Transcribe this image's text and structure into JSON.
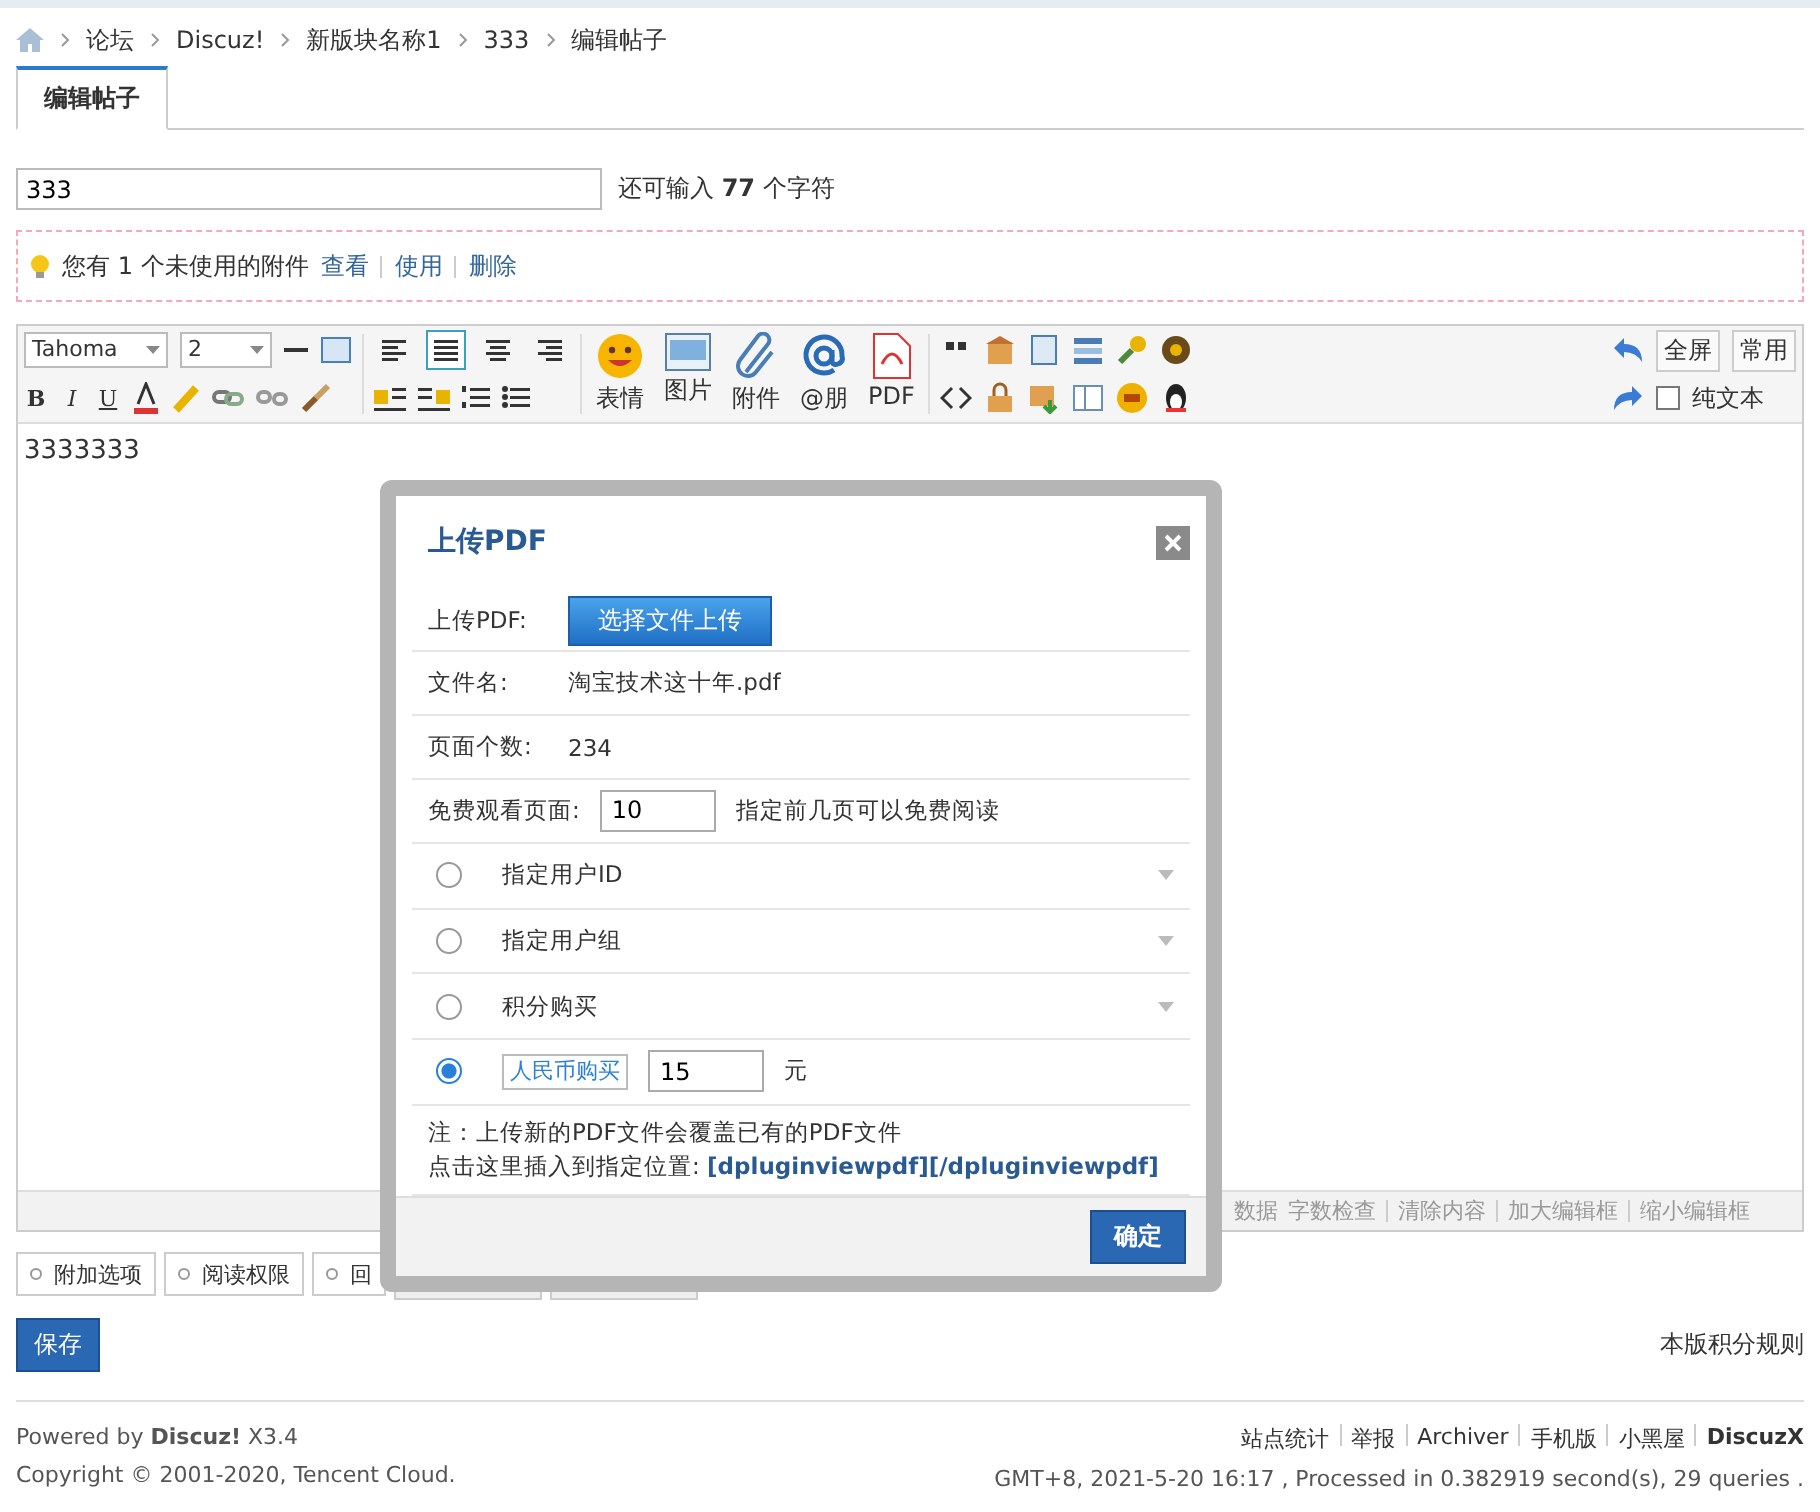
{
  "breadcrumb": [
    "论坛",
    "Discuz!",
    "新版块名称1",
    "333",
    "编辑帖子"
  ],
  "tabs": [
    {
      "label": "编辑帖子",
      "selected": true
    }
  ],
  "subject": {
    "value": "333",
    "hint_prefix": "还可输入",
    "hint_count": "77",
    "hint_suffix": "个字符"
  },
  "notice": {
    "text": "您有 1 个未使用的附件",
    "links": [
      "查看",
      "使用",
      "删除"
    ]
  },
  "toolbar": {
    "font": "Tahoma",
    "size": "2",
    "format_labels": [
      "B",
      "I",
      "U"
    ],
    "align_buttons": [
      {
        "selected": false
      },
      {
        "selected": true
      },
      {
        "selected": false
      },
      {
        "selected": false
      }
    ],
    "big_buttons": [
      {
        "kind": "smiley",
        "label": "表情"
      },
      {
        "kind": "image",
        "label": "图片"
      },
      {
        "kind": "attach",
        "label": "附件"
      },
      {
        "kind": "at",
        "label": "@朋"
      },
      {
        "kind": "pdf",
        "label": "PDF"
      }
    ],
    "right_buttons": [
      "全屏",
      "常用"
    ],
    "plain_text": {
      "label": "纯文本",
      "checked": false
    }
  },
  "editor_content": "3333333",
  "editor_footer": [
    "数据",
    "字数检查",
    "清除内容",
    "加大编辑框",
    "缩小编辑框"
  ],
  "option_tabs": [
    "附加选项",
    "阅读权限",
    "回"
  ],
  "save_button": "保存",
  "rules_link": "本版积分规则",
  "footer": {
    "powered_prefix": "Powered by",
    "brand": "Discuz!",
    "version": "X3.4",
    "copyright": "Copyright © 2001-2020, Tencent Cloud.",
    "links": [
      "站点统计",
      "举报",
      "Archiver",
      "手机版",
      "小黑屋",
      "DiscuzX"
    ],
    "stats": "GMT+8, 2021-5-20 16:17 , Processed in 0.382919 second(s), 29 queries ."
  },
  "dialog": {
    "title": "上传PDF",
    "upload_label": "上传PDF:",
    "upload_button": "选择文件上传",
    "filename_label": "文件名:",
    "filename": "淘宝技术这十年.pdf",
    "pages_label": "页面个数:",
    "pages": "234",
    "free_label": "免费观看页面:",
    "free_value": "10",
    "free_hint": "指定前几页可以免费阅读",
    "options": [
      {
        "label": "指定用户ID",
        "selected": false,
        "kind": "dropdown"
      },
      {
        "label": "指定用户组",
        "selected": false,
        "kind": "dropdown"
      },
      {
        "label": "积分购买",
        "selected": false,
        "kind": "dropdown"
      },
      {
        "label": "人民币购买",
        "selected": true,
        "kind": "price",
        "value": "15",
        "unit": "元"
      }
    ],
    "note": "注：上传新的PDF文件会覆盖已有的PDF文件",
    "insert_label": "点击这里插入到指定位置:",
    "insert_code": "[dpluginviewpdf][/dpluginviewpdf]",
    "confirm": "确定"
  }
}
